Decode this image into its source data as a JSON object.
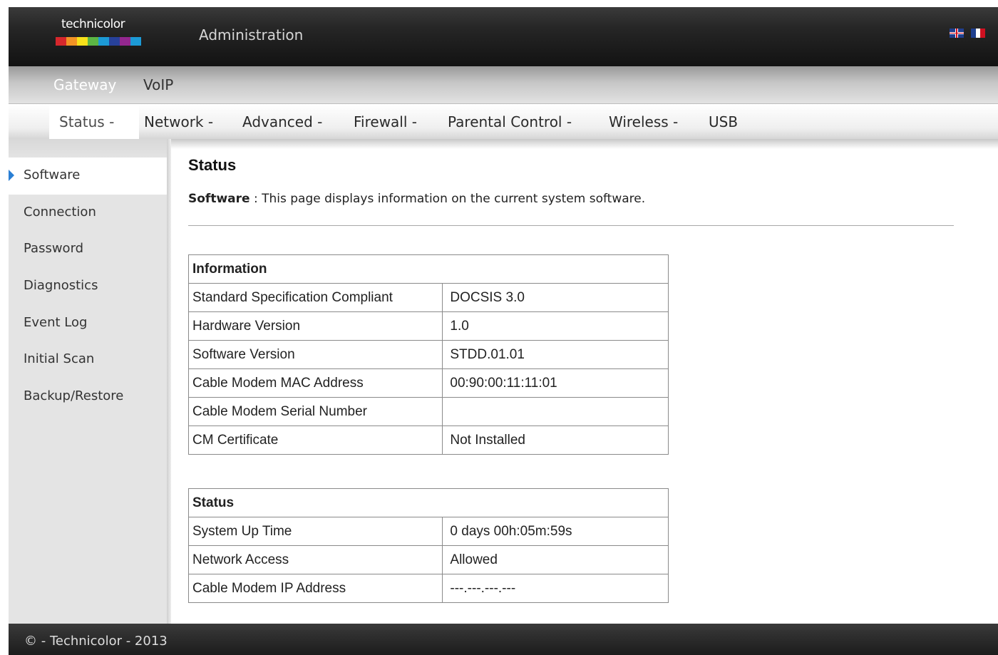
{
  "header": {
    "logo_text": "technicolor",
    "title": "Administration",
    "flags": [
      "uk-flag-icon",
      "fr-flag-icon"
    ]
  },
  "nav1": {
    "items": [
      "Gateway",
      "VoIP"
    ],
    "active": "Gateway"
  },
  "nav2": {
    "items": [
      "Status -",
      "Network -",
      "Advanced -",
      "Firewall -",
      "Parental Control -",
      "Wireless -",
      "USB"
    ],
    "active": "Status -"
  },
  "sidebar": {
    "items": [
      "Software",
      "Connection",
      "Password",
      "Diagnostics",
      "Event Log",
      "Initial Scan",
      "Backup/Restore"
    ],
    "active": "Software"
  },
  "main": {
    "heading": "Status",
    "desc_label": "Software",
    "desc_sep": " : ",
    "desc_text": "This page displays information on the current system software.",
    "information_table": {
      "title": "Information",
      "rows": [
        {
          "label": "Standard Specification Compliant",
          "value": "DOCSIS 3.0"
        },
        {
          "label": "Hardware Version",
          "value": "1.0"
        },
        {
          "label": "Software Version",
          "value": "STDD.01.01"
        },
        {
          "label": "Cable Modem MAC Address",
          "value": "00:90:00:11:11:01"
        },
        {
          "label": "Cable Modem Serial Number",
          "value": ""
        },
        {
          "label": "CM Certificate",
          "value": "Not Installed"
        }
      ]
    },
    "status_table": {
      "title": "Status",
      "rows": [
        {
          "label": "System Up Time",
          "value": "0 days 00h:05m:59s"
        },
        {
          "label": "Network Access",
          "value": "Allowed"
        },
        {
          "label": "Cable Modem IP Address",
          "value": "---.---.---.---"
        }
      ]
    }
  },
  "footer": {
    "text": "© - Technicolor - 2013"
  },
  "colors": {
    "accent": "#2a7fd4",
    "header_bg": "#1a1a1a",
    "sidebar_bg": "#e4e4e4"
  }
}
